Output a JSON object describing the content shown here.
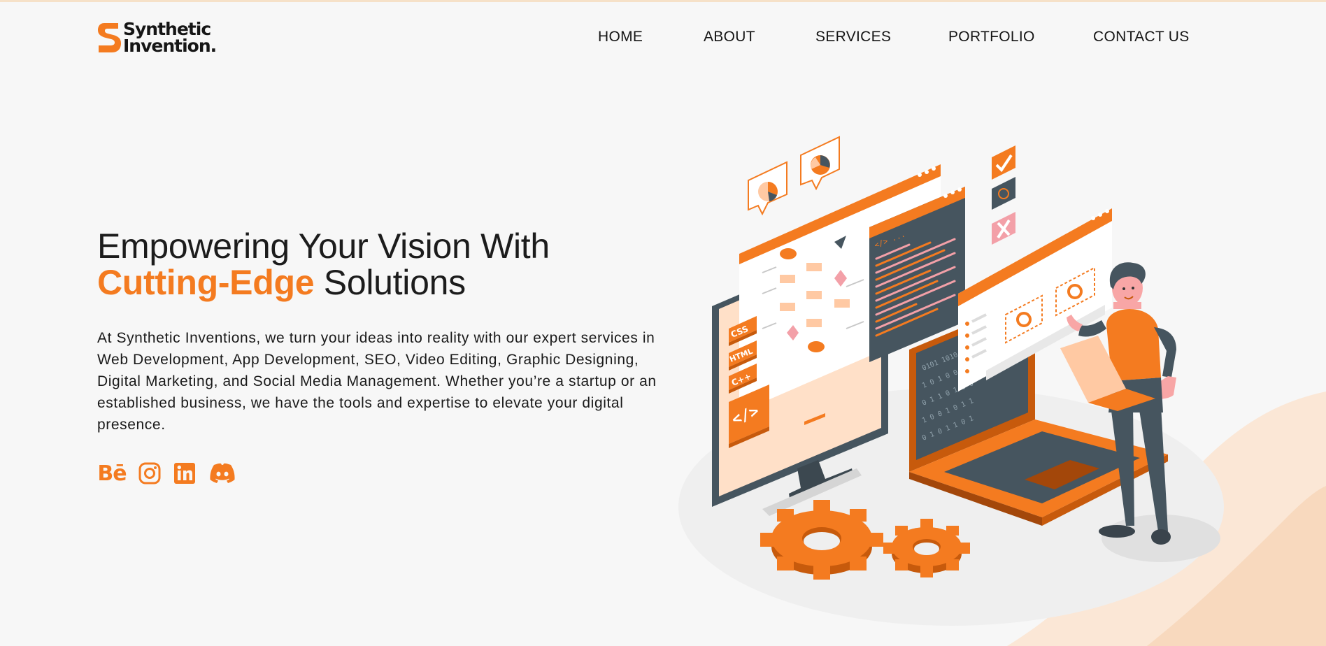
{
  "brand": {
    "line1": "Synthetic",
    "line2": "Invention",
    "dot": ".",
    "accent_color": "#f47b20"
  },
  "nav": {
    "items": [
      {
        "label": "HOME"
      },
      {
        "label": "ABOUT"
      },
      {
        "label": "SERVICES"
      },
      {
        "label": "PORTFOLIO"
      },
      {
        "label": "CONTACT US"
      }
    ]
  },
  "hero": {
    "title_line1": "Empowering Your Vision With",
    "title_accent": "Cutting-Edge",
    "title_rest": " Solutions",
    "description": "At Synthetic Inventions, we turn your ideas into reality with our expert services in Web Development, App Development, SEO, Video Editing, Graphic Designing, Digital Marketing, and Social Media Management. Whether you’re a startup or an established business, we have the tools and expertise to elevate your digital presence."
  },
  "socials": [
    {
      "icon": "behance-icon",
      "text": "Bē"
    },
    {
      "icon": "instagram-icon"
    },
    {
      "icon": "linkedin-icon"
    },
    {
      "icon": "discord-icon"
    }
  ],
  "illustration": {
    "tags": [
      "CSS",
      "HTML",
      "C++"
    ],
    "code_symbol": "</>",
    "code_hint": "</> ..."
  }
}
